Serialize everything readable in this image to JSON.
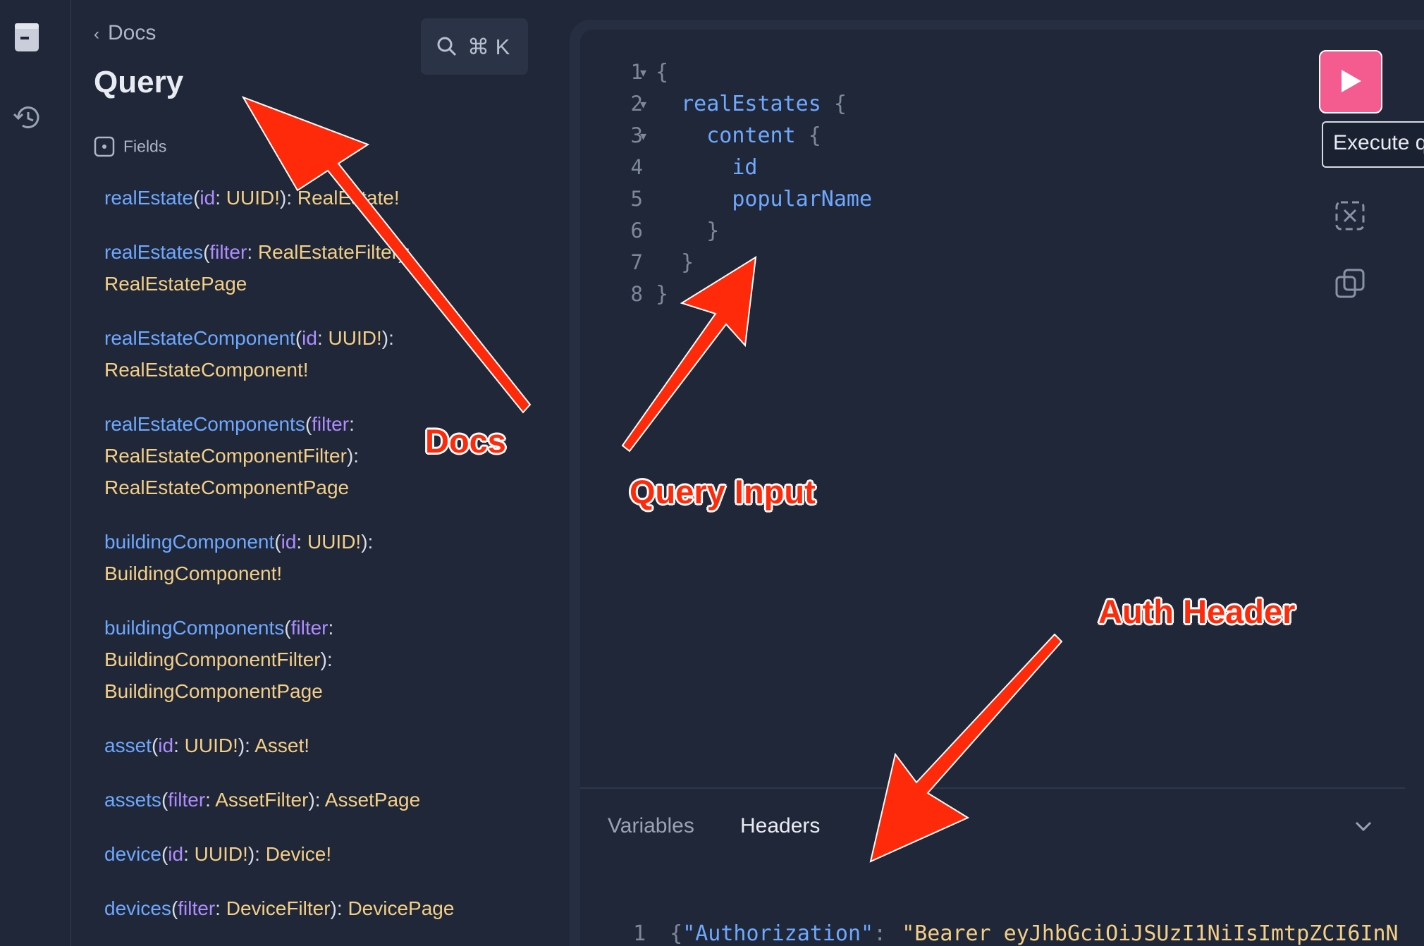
{
  "rail": {
    "icons": [
      "docs-icon",
      "history-icon"
    ]
  },
  "docs": {
    "back_label": "Docs",
    "title": "Query",
    "search_shortcut": "⌘ K",
    "fields_header": "Fields",
    "fields": [
      {
        "name": "realEstate",
        "args": [
          {
            "name": "id",
            "type": "UUID!"
          }
        ],
        "return": "RealEstate!"
      },
      {
        "name": "realEstates",
        "args": [
          {
            "name": "filter",
            "type": "RealEstateFilter"
          }
        ],
        "return": "RealEstatePage"
      },
      {
        "name": "realEstateComponent",
        "args": [
          {
            "name": "id",
            "type": "UUID!"
          }
        ],
        "return": "RealEstateComponent!"
      },
      {
        "name": "realEstateComponents",
        "args": [
          {
            "name": "filter",
            "type": "RealEstateComponentFilter"
          }
        ],
        "return": "RealEstateComponentPage"
      },
      {
        "name": "buildingComponent",
        "args": [
          {
            "name": "id",
            "type": "UUID!"
          }
        ],
        "return": "BuildingComponent!"
      },
      {
        "name": "buildingComponents",
        "args": [
          {
            "name": "filter",
            "type": "BuildingComponentFilter"
          }
        ],
        "return": "BuildingComponentPage"
      },
      {
        "name": "asset",
        "args": [
          {
            "name": "id",
            "type": "UUID!"
          }
        ],
        "return": "Asset!"
      },
      {
        "name": "assets",
        "args": [
          {
            "name": "filter",
            "type": "AssetFilter"
          }
        ],
        "return": "AssetPage"
      },
      {
        "name": "device",
        "args": [
          {
            "name": "id",
            "type": "UUID!"
          }
        ],
        "return": "Device!"
      },
      {
        "name": "devices",
        "args": [
          {
            "name": "filter",
            "type": "DeviceFilter"
          }
        ],
        "return": "DevicePage"
      }
    ]
  },
  "editor": {
    "lines": [
      {
        "n": "1",
        "fold": true,
        "tokens": [
          [
            "br",
            "{"
          ]
        ]
      },
      {
        "n": "2",
        "fold": true,
        "tokens": [
          [
            "sp",
            "  "
          ],
          [
            "kw",
            "realEstates"
          ],
          [
            "sp",
            " "
          ],
          [
            "br",
            "{"
          ]
        ]
      },
      {
        "n": "3",
        "fold": true,
        "tokens": [
          [
            "sp",
            "    "
          ],
          [
            "kw",
            "content"
          ],
          [
            "sp",
            " "
          ],
          [
            "br",
            "{"
          ]
        ]
      },
      {
        "n": "4",
        "fold": false,
        "tokens": [
          [
            "sp",
            "      "
          ],
          [
            "kw",
            "id"
          ]
        ]
      },
      {
        "n": "5",
        "fold": false,
        "tokens": [
          [
            "sp",
            "      "
          ],
          [
            "kw",
            "popularName"
          ]
        ]
      },
      {
        "n": "6",
        "fold": false,
        "tokens": [
          [
            "sp",
            "    "
          ],
          [
            "br",
            "}"
          ]
        ]
      },
      {
        "n": "7",
        "fold": false,
        "tokens": [
          [
            "sp",
            "  "
          ],
          [
            "br",
            "}"
          ]
        ]
      },
      {
        "n": "8",
        "fold": false,
        "tokens": [
          [
            "br",
            "}"
          ]
        ]
      }
    ],
    "run_tooltip": "Execute q",
    "toolbar_icons": [
      "play-icon",
      "prettify-icon",
      "copy-icon"
    ]
  },
  "bottom_tabs": {
    "variables": "Variables",
    "headers": "Headers"
  },
  "headers_editor": {
    "line_number": "1",
    "brace": "{",
    "key": "\"Authorization\"",
    "colon": ":",
    "value": "\"Bearer eyJhbGciOiJSUzI1NiIsImtpZCI6InN"
  },
  "annotations": {
    "docs": "Docs",
    "query_input": "Query Input",
    "auth_header": "Auth Header"
  },
  "colors": {
    "background": "#1f2738",
    "field_name": "#6ea8ff",
    "arg_name": "#b08cff",
    "type_name": "#f4cf86",
    "run_button": "#f45b8f",
    "annotation": "#ff2a0a"
  }
}
